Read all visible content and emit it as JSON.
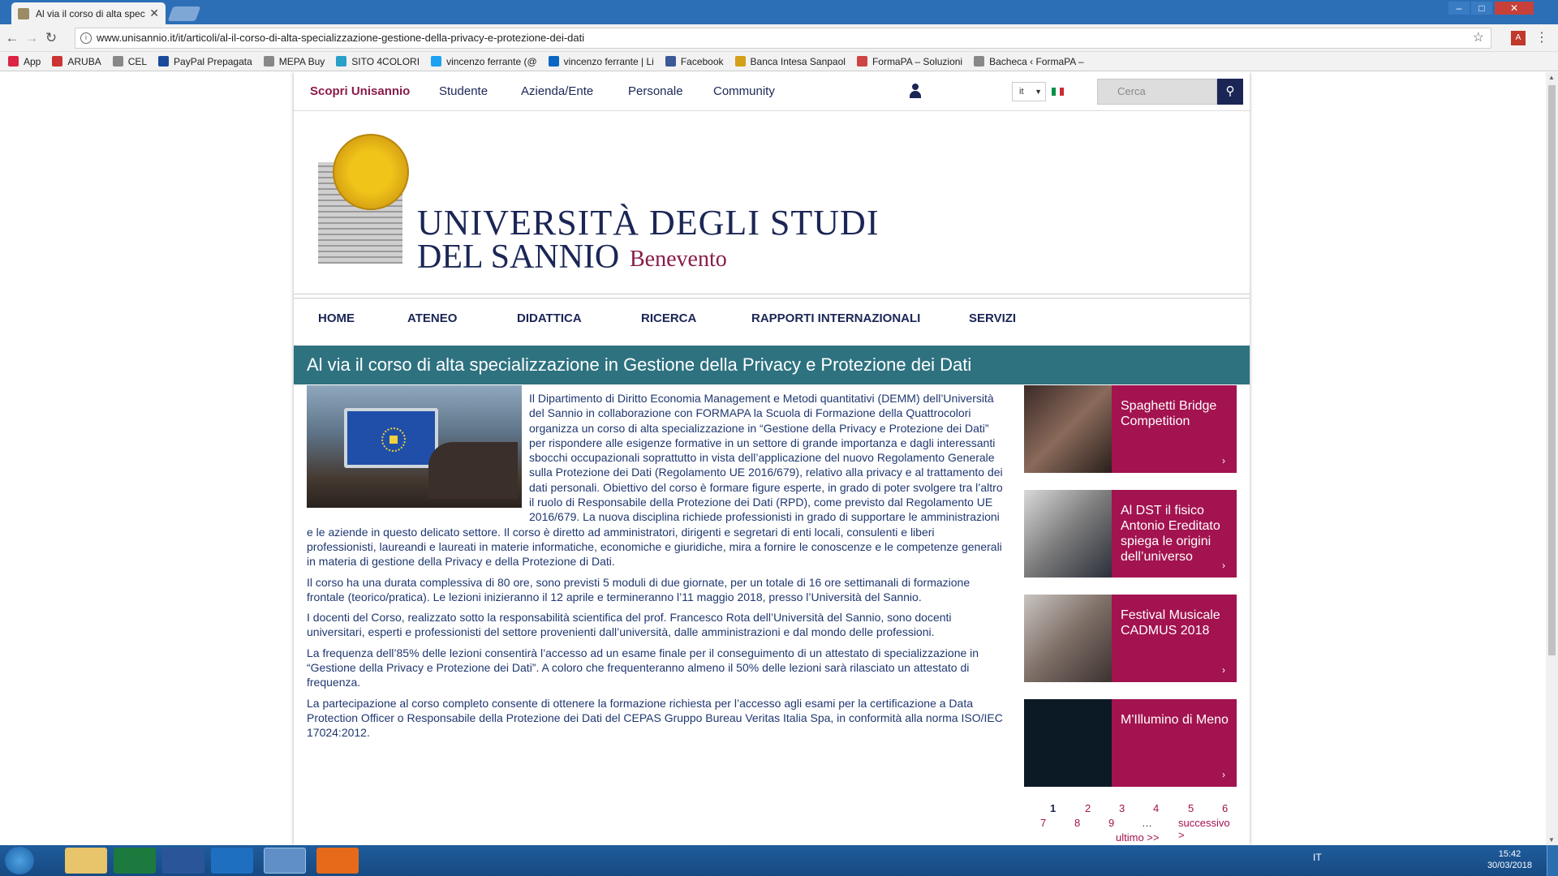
{
  "browser": {
    "tab_title": "Al via il corso di alta spec",
    "url": "www.unisannio.it/it/articoli/al-il-corso-di-alta-specializzazione-gestione-della-privacy-e-protezione-dei-dati",
    "bookmarks": [
      "App",
      "ARUBA",
      "CEL",
      "PayPal Prepagata",
      "MEPA Buy",
      "SITO 4COLORI",
      "vincenzo ferrante (@",
      "vincenzo ferrante | Li",
      "Facebook",
      "Banca Intesa Sanpaol",
      "FormaPA – Soluzioni",
      "Bacheca ‹ FormaPA –"
    ]
  },
  "topnav": {
    "scopri": "Scopri Unisannio",
    "studente": "Studente",
    "azienda": "Azienda/Ente",
    "personale": "Personale",
    "community": "Community",
    "lang": "it",
    "search_placeholder": "Cerca"
  },
  "logo": {
    "line1": "UNIVERSITÀ DEGLI STUDI",
    "line2": "DEL SANNIO",
    "city": "Benevento"
  },
  "mainnav": [
    "HOME",
    "ATENEO",
    "DIDATTICA",
    "RICERCA",
    "RAPPORTI INTERNAZIONALI",
    "SERVIZI"
  ],
  "article": {
    "title": "Al via il corso di alta specializzazione in Gestione della Privacy e Protezione dei Dati",
    "paragraphs": [
      "Il Dipartimento di Diritto Economia Management e Metodi quantitativi (DEMM) dell’Università del Sannio in collaborazione con FORMAPA la Scuola di Formazione della Quattrocolori organizza un corso di alta specializzazione in “Gestione della Privacy e Protezione dei Dati” per rispondere alle esigenze formative in un settore di grande importanza e dagli interessanti sbocchi occupazionali soprattutto in vista dell’applicazione del nuovo Regolamento Generale sulla Protezione dei Dati (Regolamento UE 2016/679), relativo alla privacy e al trattamento dei dati personali. Obiettivo del corso è formare figure esperte, in grado di poter svolgere tra l’altro il ruolo di Responsabile della Protezione dei Dati (RPD), come previsto dal Regolamento UE 2016/679. La nuova disciplina richiede professionisti in grado di supportare le amministrazioni e le aziende in questo delicato settore. Il corso è diretto ad amministratori, dirigenti e segretari di enti locali, consulenti e liberi professionisti, laureandi e laureati in materie informatiche, economiche e giuridiche, mira a fornire le conoscenze e le competenze generali in materia di gestione della Privacy e della Protezione di Dati.",
      "Il corso ha una durata complessiva di 80 ore, sono previsti 5 moduli di due giornate, per un totale di 16 ore settimanali di formazione frontale (teorico/pratica). Le lezioni inizieranno il 12 aprile  e termineranno l’11 maggio 2018, presso l’Università del Sannio.",
      "I docenti del Corso, realizzato sotto la responsabilità scientifica del prof. Francesco Rota dell’Università del Sannio, sono docenti universitari, esperti e professionisti del settore provenienti dall’università, dalle amministrazioni e dal mondo delle professioni.",
      "La frequenza dell’85% delle lezioni consentirà l’accesso ad un esame finale per il conseguimento di un attestato di specializzazione in “Gestione della Privacy e Protezione dei Dati”. A coloro che frequenteranno almeno il 50% delle lezioni sarà rilasciato un attestato di frequenza.",
      "La partecipazione al corso completo consente di ottenere la formazione richiesta per l’accesso agli esami per la certificazione a Data Protection Officer o Responsabile della Protezione dei Dati del CEPAS Gruppo Bureau Veritas Italia Spa, in conformità alla norma ISO/IEC 17024:2012."
    ]
  },
  "sidebar": [
    {
      "title": "Spaghetti Bridge Competition"
    },
    {
      "title": "Al DST il fisico Antonio Ereditato spiega le origini dell’universo"
    },
    {
      "title": "Festival Musicale CADMUS 2018"
    },
    {
      "title": "M'Illumino di Meno"
    }
  ],
  "pager": {
    "pages": [
      "1",
      "2",
      "3",
      "4",
      "5",
      "6",
      "7",
      "8",
      "9",
      "…"
    ],
    "next": "successivo >",
    "last": "ultimo >>"
  },
  "taskbar": {
    "lang": "IT",
    "time": "15:42",
    "date": "30/03/2018"
  },
  "colors": {
    "navy": "#1b2656",
    "maroon": "#a3134f",
    "teal": "#2e7280"
  }
}
